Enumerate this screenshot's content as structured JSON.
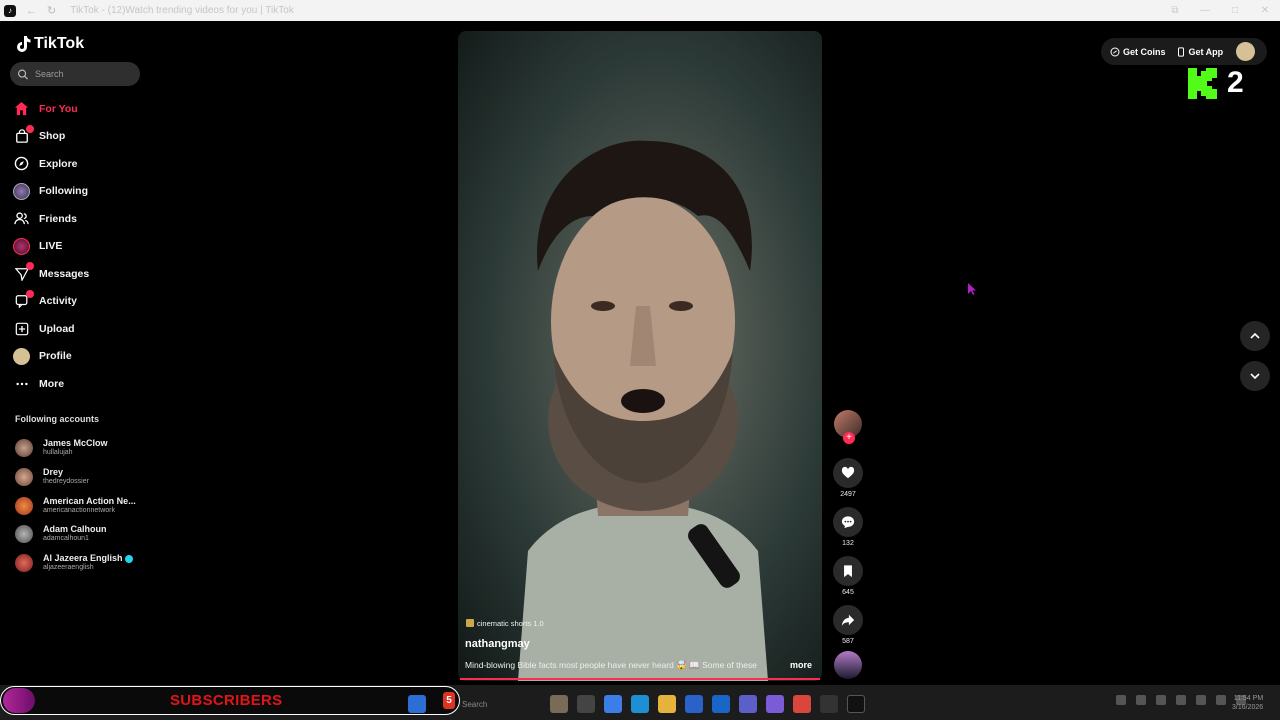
{
  "window": {
    "title": "TikTok - (12)Watch trending videos for you | TikTok",
    "controls": [
      "⧉",
      "—",
      "□",
      "✕"
    ]
  },
  "brand": {
    "name": "TikTok"
  },
  "search": {
    "placeholder": "Search"
  },
  "nav": {
    "items": [
      {
        "label": "For You",
        "icon": "home-icon"
      },
      {
        "label": "Shop",
        "icon": "shop-bag-icon"
      },
      {
        "label": "Explore",
        "icon": "compass-icon"
      },
      {
        "label": "Following",
        "icon": "following-avatar-icon"
      },
      {
        "label": "Friends",
        "icon": "friends-icon"
      },
      {
        "label": "LIVE",
        "icon": "live-icon"
      },
      {
        "label": "Messages",
        "icon": "messages-icon"
      },
      {
        "label": "Activity",
        "icon": "activity-icon"
      },
      {
        "label": "Upload",
        "icon": "upload-icon"
      },
      {
        "label": "Profile",
        "icon": "profile-avatar-icon"
      },
      {
        "label": "More",
        "icon": "more-icon"
      }
    ]
  },
  "following": {
    "title": "Following accounts",
    "accounts": [
      {
        "name": "James McClow",
        "handle": "hullalujah",
        "color": "#8a6b5a"
      },
      {
        "name": "Drey",
        "handle": "thedreydossier",
        "color": "#a07a68"
      },
      {
        "name": "American Action Ne...",
        "handle": "americanactionnetwork",
        "color": "#c0552a"
      },
      {
        "name": "Adam Calhoun",
        "handle": "adamcalhoun1",
        "color": "#7a7a7a"
      },
      {
        "name": "Al Jazeera English",
        "handle": "aljazeeraenglish",
        "color": "#b33a3a",
        "verified": true
      }
    ]
  },
  "video": {
    "tag": "cinematic shorts 1.0",
    "username": "nathangmay",
    "description": "Mind-blowing Bible facts most people have never heard 🤯 📖  Some of these",
    "more_label": "more"
  },
  "actions": {
    "likes": "2497",
    "comments": "132",
    "saves": "645",
    "shares": "587"
  },
  "topbar": {
    "get_coins": "Get Coins",
    "get_app": "Get App"
  },
  "overlay": {
    "number": "2"
  },
  "stream_banner": {
    "text": "SUBSCRIBERS",
    "count": "5"
  },
  "taskbar": {
    "search_placeholder": "Search",
    "time": "11:54 PM",
    "date": "3/16/2026"
  },
  "colors": {
    "accent": "#fe2c55",
    "background": "#000000",
    "kick_green": "#53fc18"
  }
}
